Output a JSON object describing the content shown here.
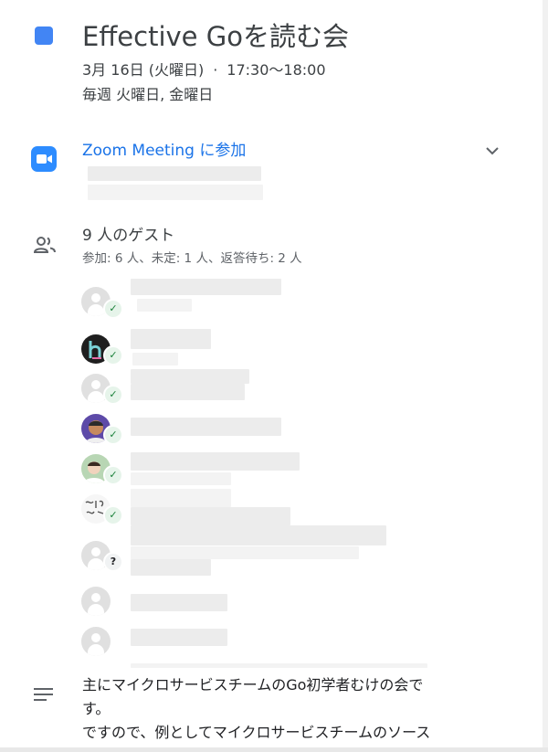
{
  "event": {
    "title": "Effective Goを読む会",
    "date": "3月 16日 (火曜日)",
    "separator": "·",
    "time": "17:30〜18:00",
    "recurrence": "毎週 火曜日, 金曜日",
    "color": "#4285f4"
  },
  "conference": {
    "link_label": "Zoom Meeting に参加",
    "icon": "zoom-video-icon",
    "expand_icon": "chevron-down-icon"
  },
  "guests": {
    "icon": "people-icon",
    "title": "9 人のゲスト",
    "summary": "参加: 6 人、未定: 1 人、返答待ち: 2 人",
    "list": [
      {
        "avatar": "default-avatar",
        "status": "accepted"
      },
      {
        "avatar": "h-logo-avatar",
        "status": "accepted"
      },
      {
        "avatar": "default-avatar",
        "status": "accepted"
      },
      {
        "avatar": "photo-avatar",
        "status": "accepted"
      },
      {
        "avatar": "photo-avatar",
        "status": "accepted"
      },
      {
        "avatar": "handwriting-avatar",
        "status": "accepted"
      },
      {
        "avatar": "default-avatar",
        "status": "maybe",
        "badge": "?"
      },
      {
        "avatar": "default-avatar",
        "status": "pending"
      },
      {
        "avatar": "default-avatar",
        "status": "pending"
      }
    ],
    "accepted_badge": "✓",
    "accent_color": "#188038"
  },
  "description": {
    "icon": "notes-icon",
    "lines": [
      "主にマイクロサービスチームのGo初学者むけの会で",
      "す。",
      "ですので、例としてマイクロサービスチームのソース"
    ]
  }
}
